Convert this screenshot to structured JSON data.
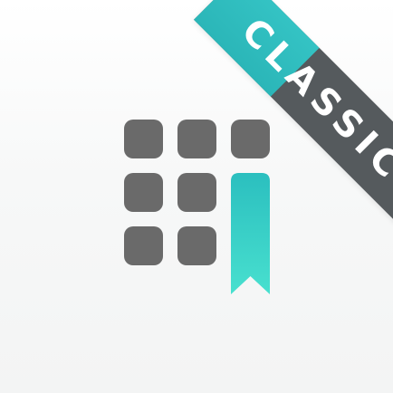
{
  "banner": {
    "label": "CLASSIC"
  },
  "colors": {
    "tile": "#6a6a6a",
    "bookmark_top": "#2bbfbf",
    "bookmark_bottom": "#48e0cf",
    "banner_dark": "#555a5d",
    "banner_teal": "#2bb6b8"
  },
  "icons": [
    "grid-icon",
    "bookmark-icon"
  ]
}
